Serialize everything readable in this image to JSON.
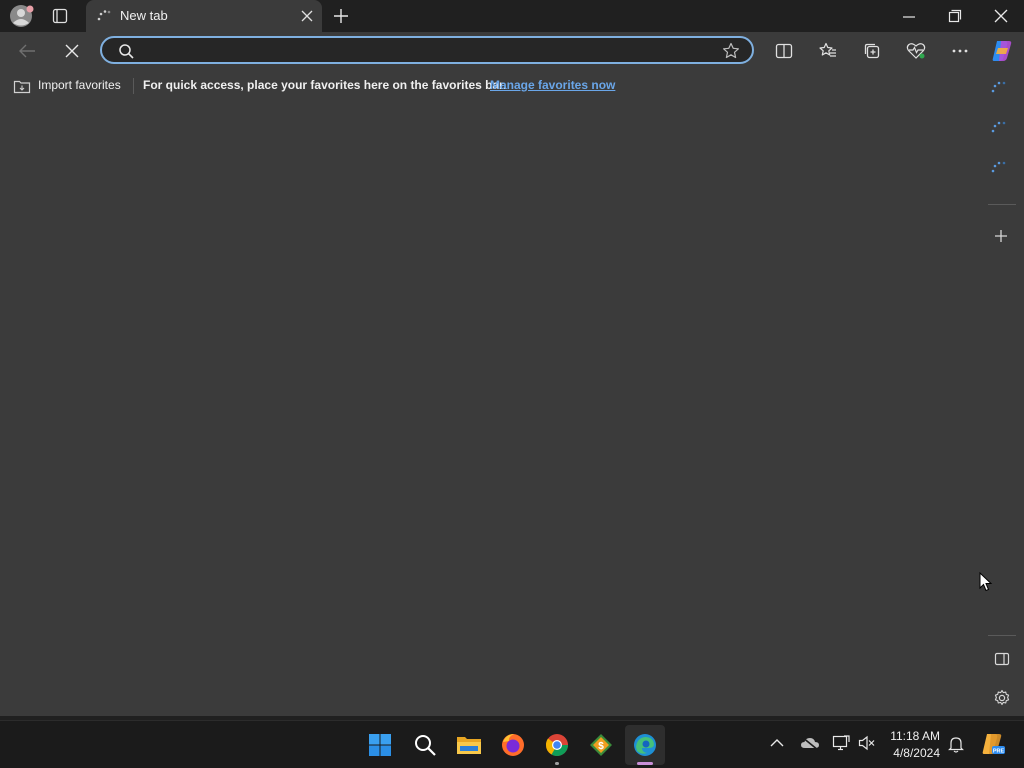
{
  "tab": {
    "title": "New tab"
  },
  "address_bar": {
    "value": "",
    "placeholder": ""
  },
  "favorites_bar": {
    "import_label": "Import favorites",
    "message": "For quick access, place your favorites here on the favorites bar.",
    "manage_link": "Manage favorites now"
  },
  "taskbar": {
    "time": "11:18 AM",
    "date": "4/8/2024",
    "apps": [
      "start",
      "search",
      "file-explorer",
      "firefox",
      "chrome",
      "app",
      "edge"
    ]
  },
  "colors": {
    "accent": "#7fb0e0",
    "link": "#6aa6e8",
    "content_bg": "#3b3b3b"
  }
}
